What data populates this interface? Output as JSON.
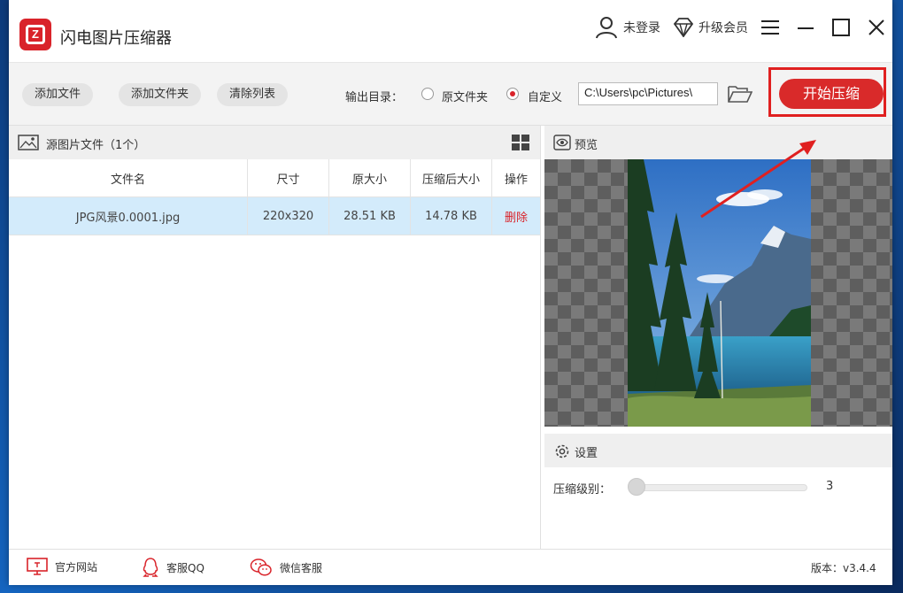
{
  "app": {
    "title": "闪电图片压缩器"
  },
  "titlebar": {
    "login": "未登录",
    "upgrade": "升级会员"
  },
  "toolbar": {
    "add_file": "添加文件",
    "add_folder": "添加文件夹",
    "clear_list": "清除列表",
    "output_label": "输出目录：",
    "option_original": "原文件夹",
    "option_custom": "自定义",
    "output_path": "C:\\Users\\pc\\Pictures\\",
    "start_button": "开始压缩"
  },
  "file_list": {
    "header": "源图片文件（1个）",
    "columns": [
      "文件名",
      "尺寸",
      "原大小",
      "压缩后大小",
      "操作"
    ],
    "rows": [
      {
        "name": "JPG风景0.0001.jpg",
        "size": "220x320",
        "original": "28.51 KB",
        "compressed": "14.78 KB",
        "action": "删除"
      }
    ]
  },
  "preview": {
    "header": "预览"
  },
  "settings": {
    "header": "设置",
    "level_label": "压缩级别：",
    "level_value": "3",
    "level_fraction": 0.0
  },
  "footer": {
    "website": "官方网站",
    "qq": "客服QQ",
    "wechat": "微信客服",
    "version": "版本：v3.4.4"
  },
  "colors": {
    "accent": "#d9232a",
    "selected_row": "#d3ebfb",
    "annotation": "#e02020"
  },
  "icons": [
    "user-icon",
    "diamond-icon",
    "menu-icon",
    "minimize-icon",
    "maximize-icon",
    "close-icon",
    "folder-open-icon",
    "image-icon",
    "grid-view-icon",
    "eye-icon",
    "gear-icon",
    "monitor-icon",
    "qq-icon",
    "wechat-icon"
  ]
}
